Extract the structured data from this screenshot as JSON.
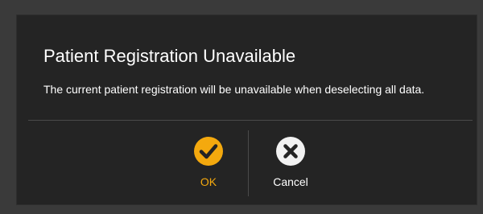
{
  "dialog": {
    "title": "Patient Registration Unavailable",
    "message": "The current patient registration will be unavailable when deselecting all data."
  },
  "actions": {
    "ok": {
      "label": "OK",
      "icon": "checkmark-circle-icon",
      "color": "#f4a90e"
    },
    "cancel": {
      "label": "Cancel",
      "icon": "x-circle-icon",
      "color": "#ffffff"
    }
  },
  "colors": {
    "background": "#3a3a3a",
    "dialog_background": "#242424",
    "accent": "#f4a90e",
    "text": "#ffffff",
    "divider": "#4a4a4a"
  }
}
